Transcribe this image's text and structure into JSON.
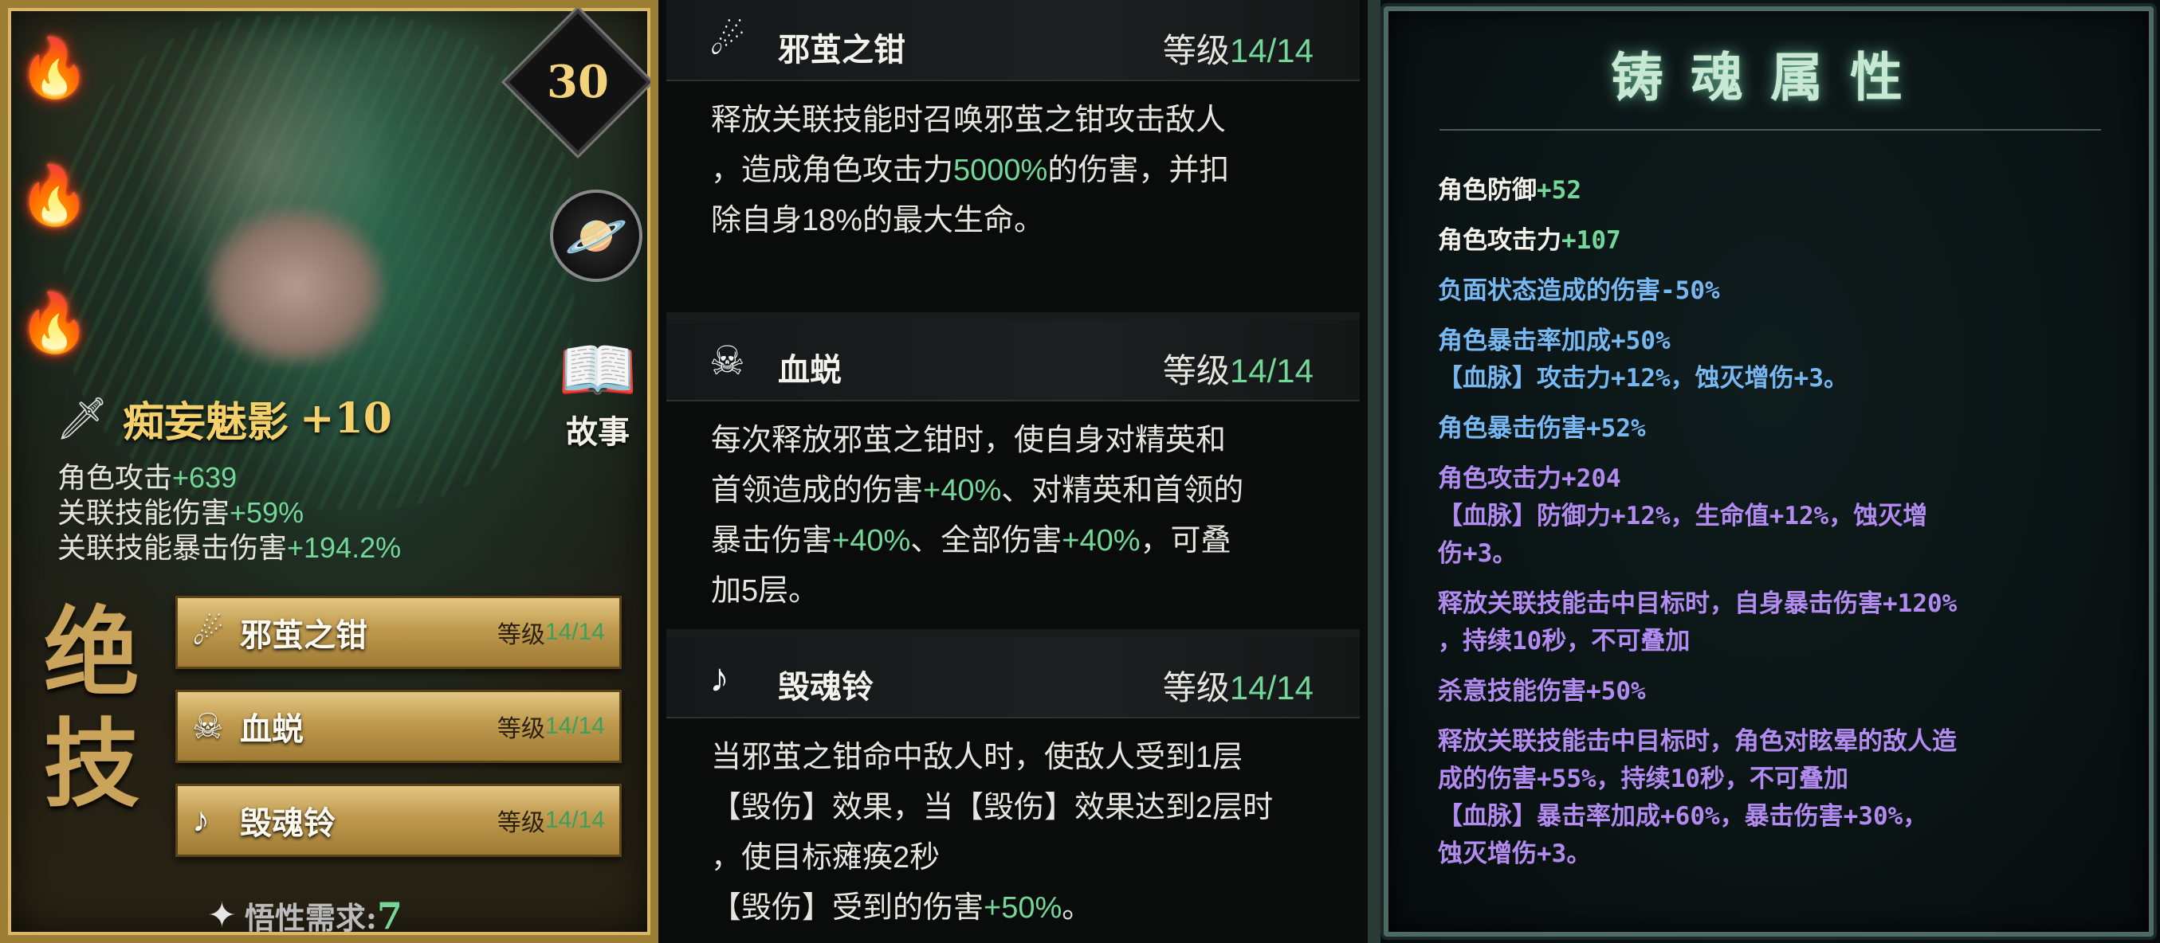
{
  "card": {
    "level": "30",
    "story_label": "故事",
    "weapon_name": "痴妄魅影",
    "weapon_plus": "+10",
    "stats": [
      {
        "label": "角色攻击",
        "value": "+639"
      },
      {
        "label": "关联技能伤害",
        "value": "+59%"
      },
      {
        "label": "关联技能暴击伤害",
        "value": "+194.2%"
      }
    ],
    "ultimate_label": "绝技",
    "skills": [
      {
        "name": "邪茧之钳",
        "level_label": "等级",
        "level_value": "14/14"
      },
      {
        "name": "血蜕",
        "level_label": "等级",
        "level_value": "14/14"
      },
      {
        "name": "毁魂铃",
        "level_label": "等级",
        "level_value": "14/14"
      }
    ],
    "wuxing_label": "悟性需求:",
    "wuxing_value": "7"
  },
  "skill_details": [
    {
      "name": "邪茧之钳",
      "level_label": "等级",
      "level_value": "14/14",
      "desc_1": "释放关联技能时召唤邪茧之钳攻击敌人",
      "desc_2a": "，造成角色攻击力",
      "desc_2b": "5000%",
      "desc_2c": "的伤害，并扣",
      "desc_3": "除自身18%的最大生命。"
    },
    {
      "name": "血蜕",
      "level_label": "等级",
      "level_value": "14/14",
      "desc_1": "每次释放邪茧之钳时，使自身对精英和",
      "desc_2a": "首领造成的伤害",
      "desc_2b": "+40%",
      "desc_2c": "、对精英和首领的",
      "desc_3a": "暴击伤害",
      "desc_3b": "+40%",
      "desc_3c": "、全部伤害",
      "desc_3d": "+40%",
      "desc_3e": "，可叠",
      "desc_4": "加5层。"
    },
    {
      "name": "毁魂铃",
      "level_label": "等级",
      "level_value": "14/14",
      "desc_1": "当邪茧之钳命中敌人时，使敌人受到1层",
      "desc_2": "【毁伤】效果，当【毁伤】效果达到2层时",
      "desc_3": "，使目标瘫痪2秒",
      "desc_4a": "【毁伤】受到的伤害",
      "desc_4b": "+50%",
      "desc_4c": "。"
    }
  ],
  "forge": {
    "title": "铸魂属性",
    "items": [
      {
        "label": "角色防御",
        "value": "+52",
        "color": "#f3f1ea"
      },
      {
        "label": "角色攻击力",
        "value": "+107",
        "color": "#f3f1ea"
      },
      {
        "label": "负面状态造成的伤害-50%",
        "value": "",
        "color": "#78b8f2"
      },
      {
        "label": "角色暴击率加成+50%",
        "value": "",
        "color": "#78b8f2",
        "sub": "【血脉】攻击力+12%，蚀灭增伤+3。"
      },
      {
        "label": "角色暴击伤害+52%",
        "value": "",
        "color": "#78b8f2"
      },
      {
        "label": "角色攻击力+204",
        "value": "",
        "color": "#b28bf0",
        "sub": "【血脉】防御力+12%，生命值+12%，蚀灭增",
        "sub2": "伤+3。"
      },
      {
        "label": "释放关联技能击中目标时，自身暴击伤害+120%",
        "value": "",
        "color": "#b28bf0",
        "sub": "，持续10秒，不可叠加"
      },
      {
        "label": "杀意技能伤害+50%",
        "value": "",
        "color": "#b28bf0"
      },
      {
        "label": "释放关联技能击中目标时，角色对眩晕的敌人造",
        "value": "",
        "color": "#b28bf0",
        "sub": "成的伤害+55%，持续10秒，不可叠加",
        "sub2": "【血脉】暴击率加成+60%，暴击伤害+30%，",
        "sub3": "蚀灭增伤+3。"
      }
    ]
  },
  "colors": {
    "accent_green": "#74d79a",
    "gold": "#f3d06a",
    "blue_text": "#78b8f2",
    "purple_text": "#b28bf0"
  },
  "icons": [
    "flame-icon",
    "planet-icon",
    "book-icon",
    "sword-icon",
    "wuxing-icon",
    "claw-icon",
    "skull-icon",
    "bell-icon"
  ]
}
